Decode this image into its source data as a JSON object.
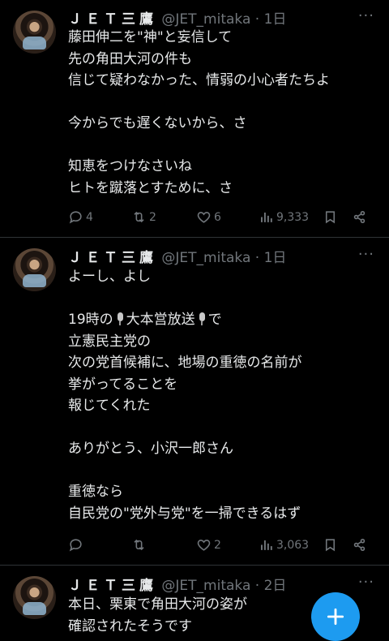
{
  "tweets": [
    {
      "name": "ＪＥＴ三鷹",
      "meta": "@JET_mitaka · 1日",
      "text": "藤田伸二を\"神\"と妄信して\n先の角田大河の件も\n信じて疑わなかった、情弱の小心者たちよ\n\n今からでも遅くないから、さ\n\n知恵をつけなさいね\nヒトを蹴落とすために、さ",
      "replies": "4",
      "retweets": "2",
      "likes": "6",
      "views": "9,333"
    },
    {
      "name": "ＪＥＴ三鷹",
      "meta": "@JET_mitaka · 1日",
      "text_lines": [
        "よーし、よし",
        "",
        "19時の",
        "大本営放送",
        "で",
        "立憲民主党の\n次の党首候補に、地場の重徳の名前が\n挙がってることを\n報じてくれた\n\nありがとう、小沢一郎さん\n\n重徳なら\n自民党の\"党外与党\"を一掃できるはず"
      ],
      "replies": "",
      "retweets": "",
      "likes": "2",
      "views": "3,063"
    },
    {
      "name": "ＪＥＴ三鷹",
      "meta": "@JET_mitaka · 2日",
      "text": "本日、栗東で角田大河の姿が\n確認されたそうです"
    }
  ],
  "icons": {
    "reply": "reply-icon",
    "retweet": "retweet-icon",
    "like": "heart-icon",
    "views": "views-icon",
    "bookmark": "bookmark-icon",
    "share": "share-icon",
    "more": "more-icon",
    "compose": "plus-icon"
  },
  "colors": {
    "accent": "#1d9bf0",
    "muted": "#71767b",
    "background": "#000000"
  }
}
